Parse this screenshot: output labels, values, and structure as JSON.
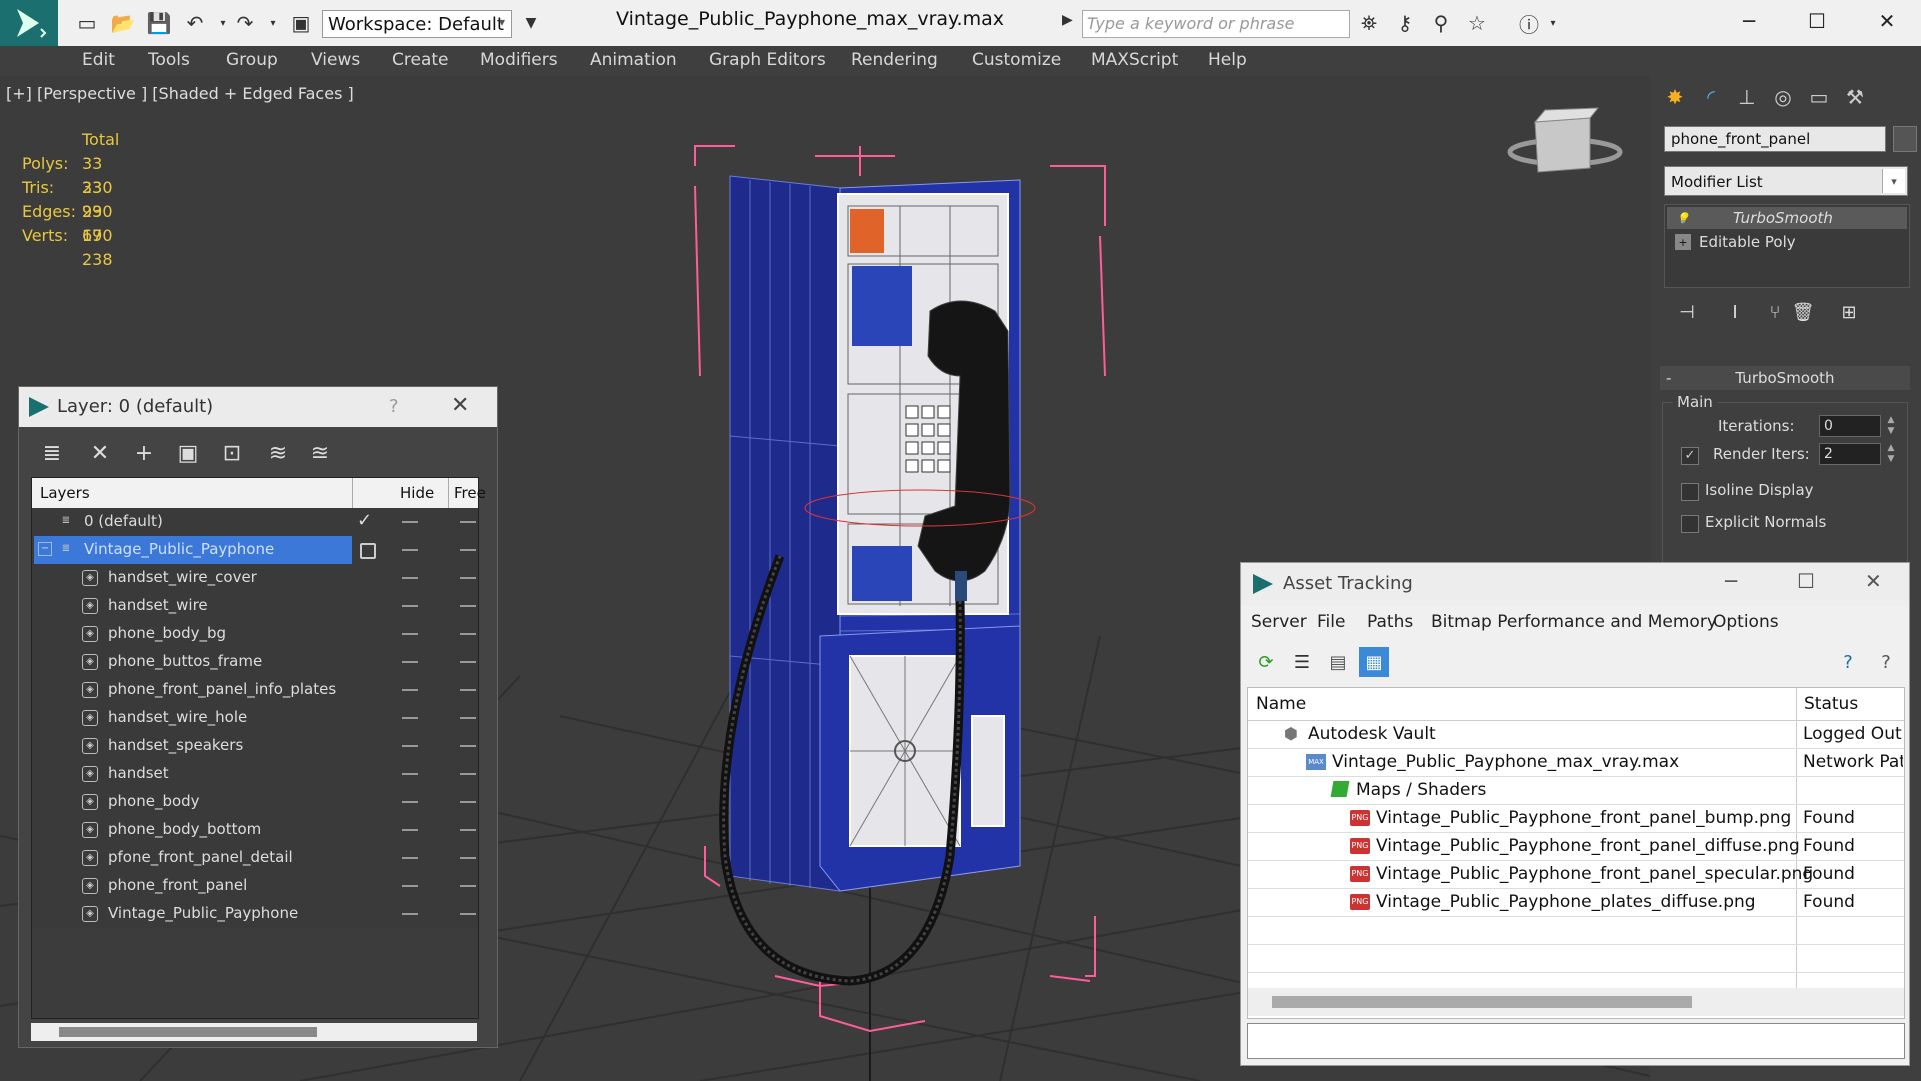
{
  "titlebar": {
    "workspace_label": "Workspace: Default",
    "window_title": "Vintage_Public_Payphone_max_vray.max",
    "search_placeholder": "Type a keyword or phrase"
  },
  "menus": [
    "Edit",
    "Tools",
    "Group",
    "Views",
    "Create",
    "Modifiers",
    "Animation",
    "Graph Editors",
    "Rendering",
    "Customize",
    "MAXScript",
    "Help"
  ],
  "viewport": {
    "label": "[+] [Perspective ] [Shaded + Edged Faces ]",
    "stats": {
      "header": "Total",
      "rows": [
        {
          "label": "Polys:",
          "value": "33 230"
        },
        {
          "label": "Tris:",
          "value": "33 230"
        },
        {
          "label": "Edges:",
          "value": "99 690"
        },
        {
          "label": "Verts:",
          "value": "17 238"
        }
      ]
    }
  },
  "command_panel": {
    "object_name": "phone_front_panel",
    "modifier_list": "Modifier List",
    "stack": [
      "TurboSmooth",
      "Editable Poly"
    ],
    "turbosmooth": {
      "title": "TurboSmooth",
      "group": "Main",
      "iterations_label": "Iterations:",
      "iterations_value": "0",
      "render_iters_label": "Render Iters:",
      "render_iters_value": "2",
      "render_iters_checked": true,
      "isoline_label": "Isoline Display",
      "explicit_normals_label": "Explicit Normals"
    }
  },
  "layer_dialog": {
    "title": "Layer: 0 (default)",
    "help": "?",
    "columns": {
      "layers": "Layers",
      "hide": "Hide",
      "freeze": "Free"
    },
    "default_layer": "0 (default)",
    "selected_layer": "Vintage_Public_Payphone",
    "objects": [
      "handset_wire_cover",
      "handset_wire",
      "phone_body_bg",
      "phone_buttos_frame",
      "phone_front_panel_info_plates",
      "handset_wire_hole",
      "handset_speakers",
      "handset",
      "phone_body",
      "phone_body_bottom",
      "pfone_front_panel_detail",
      "phone_front_panel",
      "Vintage_Public_Payphone"
    ]
  },
  "asset_tracking": {
    "title": "Asset Tracking",
    "menus": [
      "Server",
      "File",
      "Paths",
      "Bitmap Performance and Memory",
      "Options"
    ],
    "columns": {
      "name": "Name",
      "status": "Status"
    },
    "rows": [
      {
        "name": "Autodesk Vault",
        "status": "Logged Out",
        "indent": 0
      },
      {
        "name": "Vintage_Public_Payphone_max_vray.max",
        "status": "Network Path",
        "indent": 1
      },
      {
        "name": "Maps / Shaders",
        "status": "",
        "indent": 2
      },
      {
        "name": "Vintage_Public_Payphone_front_panel_bump.png",
        "status": "Found",
        "indent": 3
      },
      {
        "name": "Vintage_Public_Payphone_front_panel_diffuse.png",
        "status": "Found",
        "indent": 3
      },
      {
        "name": "Vintage_Public_Payphone_front_panel_specular.png",
        "status": "Found",
        "indent": 3
      },
      {
        "name": "Vintage_Public_Payphone_plates_diffuse.png",
        "status": "Found",
        "indent": 3
      }
    ]
  },
  "colors": {
    "accent": "#1b6f6f",
    "selection": "#3b78d8",
    "stats": "#e8c840",
    "bbox": "#ff5c9a"
  }
}
